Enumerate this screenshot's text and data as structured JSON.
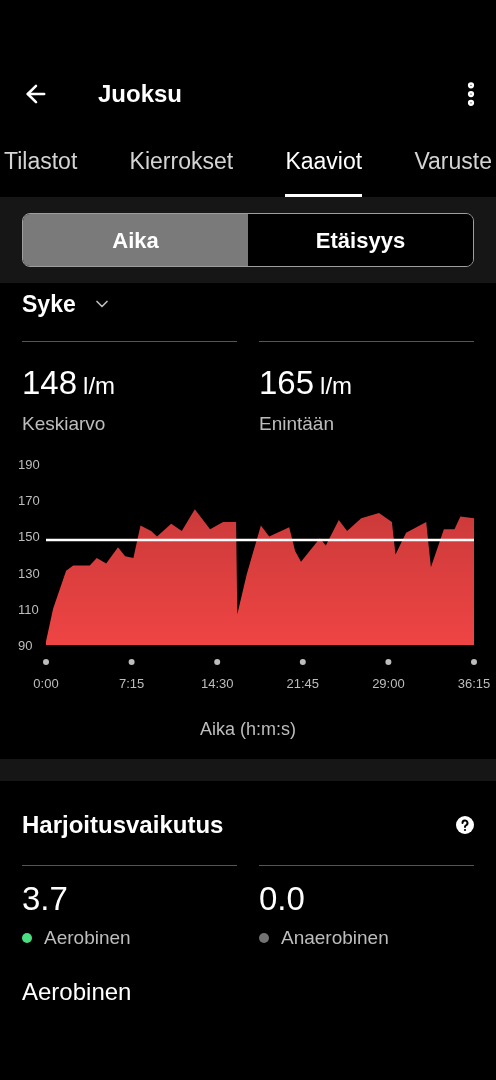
{
  "header": {
    "title": "Juoksu"
  },
  "tabs": [
    {
      "label": "Tilastot",
      "selected": false
    },
    {
      "label": "Kierrokset",
      "selected": false
    },
    {
      "label": "Kaaviot",
      "selected": true
    },
    {
      "label": "Varuste",
      "selected": false
    }
  ],
  "segments": [
    {
      "label": "Aika",
      "selected": true
    },
    {
      "label": "Etäisyys",
      "selected": false
    }
  ],
  "metric_dropdown": {
    "label": "Syke"
  },
  "stats": [
    {
      "value": "148",
      "unit": "l/m",
      "label": "Keskiarvo"
    },
    {
      "value": "165",
      "unit": "l/m",
      "label": "Enintään"
    }
  ],
  "chart_data": {
    "type": "area",
    "xlabel": "Aika (h:m:s)",
    "x": [
      0,
      0.6,
      1.7,
      2.3,
      3.7,
      4.3,
      5.1,
      6.1,
      6.7,
      7.4,
      8.0,
      8.9,
      9.4,
      10.6,
      11.5,
      12.6,
      13.9,
      15.0,
      16.1,
      16.2,
      17.0,
      18.2,
      18.9,
      20.6,
      21.1,
      21.6,
      23.2,
      23.7,
      24.8,
      25.5,
      26.7,
      28.2,
      29.3,
      29.6,
      30.5,
      32.2,
      32.6,
      33.7,
      34.6,
      35.1,
      36.25
    ],
    "series": [
      {
        "color": "#ef4444",
        "values": [
          92,
          110,
          131,
          134,
          134,
          138,
          135,
          144,
          139,
          138,
          156,
          153,
          150,
          157,
          153,
          165,
          154,
          158,
          158,
          107,
          129,
          156,
          150,
          155,
          142,
          136,
          149,
          145,
          159,
          153,
          160,
          163,
          158,
          140,
          152,
          158,
          133,
          154,
          154,
          161,
          160
        ]
      }
    ],
    "xlim": [
      0,
      36.25
    ],
    "ylim": [
      90,
      190
    ],
    "xticks": [
      {
        "value": 0,
        "label": "0:00"
      },
      {
        "value": 7.25,
        "label": "7:15"
      },
      {
        "value": 14.5,
        "label": "14:30"
      },
      {
        "value": 21.75,
        "label": "21:45"
      },
      {
        "value": 29,
        "label": "29:00"
      },
      {
        "value": 36.25,
        "label": "36:15"
      }
    ],
    "yticks": [
      90,
      110,
      130,
      150,
      170,
      190
    ],
    "ref_lines": [
      {
        "axis": "y",
        "value": 148
      }
    ]
  },
  "training_effect": {
    "title": "Harjoitusvaikutus",
    "items": [
      {
        "value": "3.7",
        "label": "Aerobinen",
        "color": "#4ade80"
      },
      {
        "value": "0.0",
        "label": "Anaerobinen",
        "color": "#737373"
      }
    ],
    "subtitle": "Aerobinen"
  }
}
